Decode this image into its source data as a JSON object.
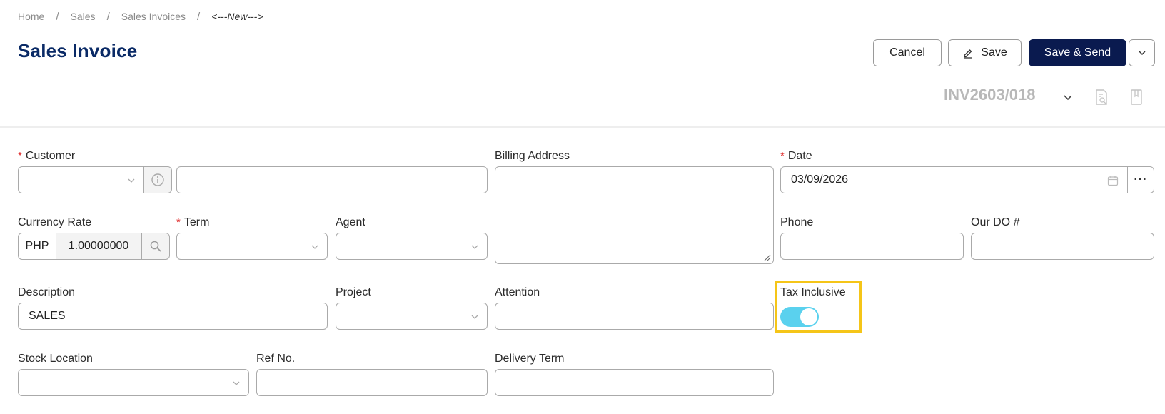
{
  "breadcrumb": {
    "items": [
      "Home",
      "Sales",
      "Sales Invoices"
    ],
    "current": "<---New--->",
    "separator": "/"
  },
  "page": {
    "title": "Sales Invoice"
  },
  "header_actions": {
    "cancel_label": "Cancel",
    "save_label": "Save",
    "save_send_label": "Save & Send"
  },
  "document": {
    "number": "INV2603/018"
  },
  "form": {
    "customer": {
      "label": "Customer",
      "required": true,
      "name_value": ""
    },
    "billing_address": {
      "label": "Billing Address",
      "value": ""
    },
    "date": {
      "label": "Date",
      "required": true,
      "value": "03/09/2026",
      "more_label": "···"
    },
    "currency_rate": {
      "label": "Currency Rate",
      "currency": "PHP",
      "rate": "1.00000000"
    },
    "term": {
      "label": "Term",
      "required": true,
      "value": ""
    },
    "agent": {
      "label": "Agent",
      "value": ""
    },
    "phone": {
      "label": "Phone",
      "value": ""
    },
    "our_do": {
      "label": "Our DO #",
      "value": ""
    },
    "description": {
      "label": "Description",
      "value": "SALES"
    },
    "project": {
      "label": "Project",
      "value": ""
    },
    "attention": {
      "label": "Attention",
      "value": ""
    },
    "tax_inclusive": {
      "label": "Tax Inclusive",
      "enabled": true
    },
    "stock_location": {
      "label": "Stock Location",
      "value": ""
    },
    "ref_no": {
      "label": "Ref No.",
      "value": ""
    },
    "delivery_term": {
      "label": "Delivery Term",
      "value": ""
    }
  },
  "colors": {
    "title": "#0a2a66",
    "primary_button": "#0a1a4f",
    "required_marker": "#e03030",
    "toggle_on": "#5ad1ee",
    "highlight": "#f5c518",
    "doc_number": "#b8b8b8"
  }
}
